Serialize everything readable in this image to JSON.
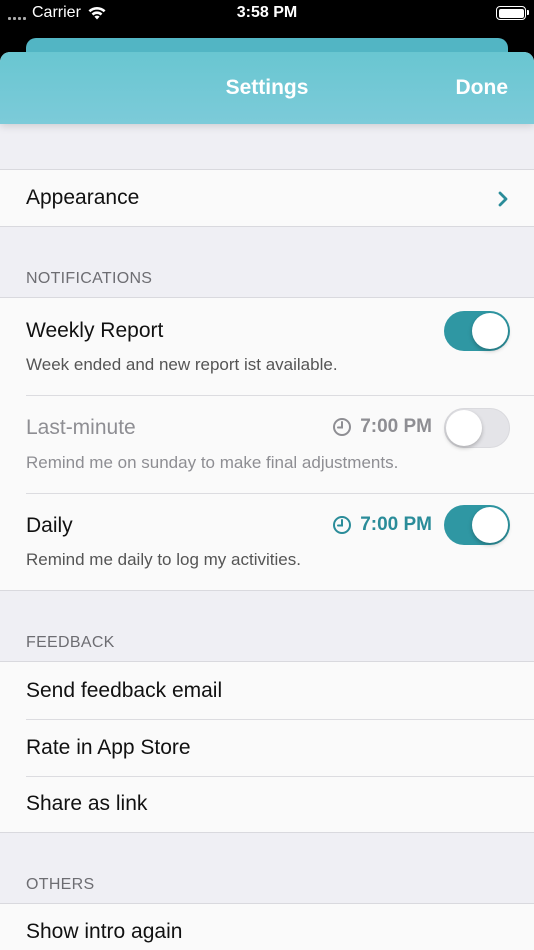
{
  "status_bar": {
    "carrier": "Carrier",
    "time": "3:58 PM"
  },
  "nav": {
    "title": "Settings",
    "done_label": "Done"
  },
  "appearance": {
    "label": "Appearance"
  },
  "notifications": {
    "header": "NOTIFICATIONS",
    "items": [
      {
        "title": "Weekly Report",
        "subtitle": "Week ended and new report ist available.",
        "enabled": true
      },
      {
        "title": "Last-minute",
        "subtitle": "Remind me on sunday to make final adjustments.",
        "time": "7:00 PM",
        "enabled": false
      },
      {
        "title": "Daily",
        "subtitle": "Remind me daily to log my activities.",
        "time": "7:00 PM",
        "enabled": true
      }
    ]
  },
  "feedback": {
    "header": "FEEDBACK",
    "items": [
      {
        "label": "Send feedback email"
      },
      {
        "label": "Rate in App Store"
      },
      {
        "label": "Share as link"
      }
    ]
  },
  "others": {
    "header": "OTHERS",
    "items": [
      {
        "label": "Show intro again"
      }
    ]
  },
  "colors": {
    "accent": "#2f97a3",
    "nav": "#72c8d5",
    "disabled_text": "#8e8e93"
  },
  "icons": {
    "chevron": "chevron-right-icon",
    "clock": "clock-icon",
    "wifi": "wifi-icon",
    "battery": "battery-icon"
  }
}
